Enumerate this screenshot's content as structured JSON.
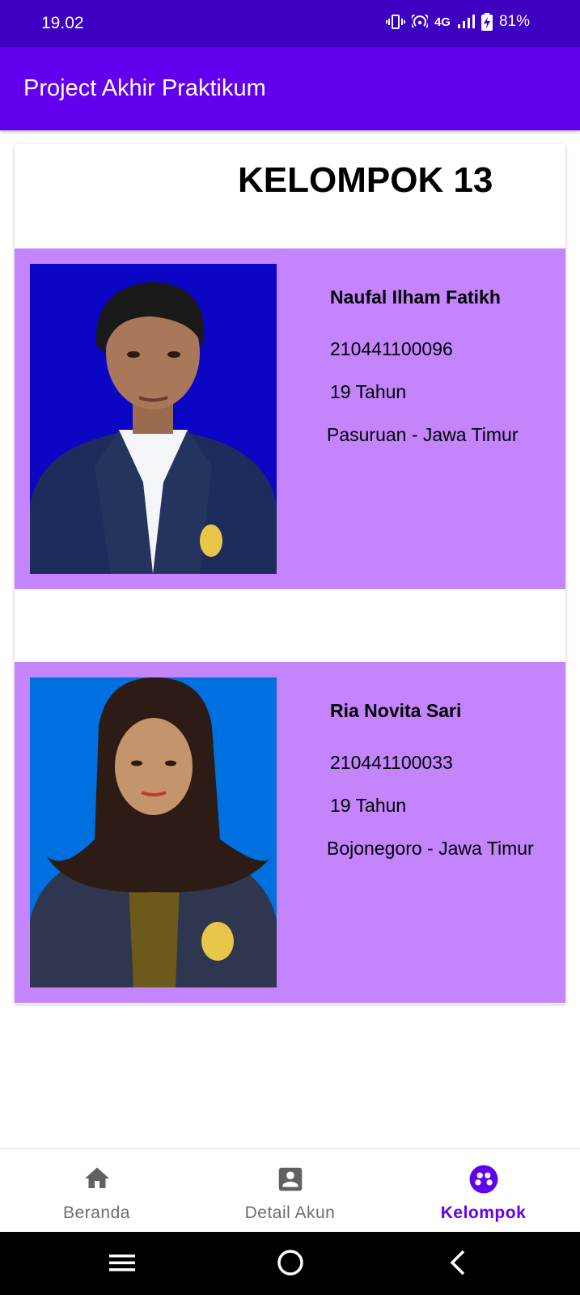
{
  "status_bar": {
    "time": "19.02",
    "network": "4G",
    "battery": "81%"
  },
  "app_bar": {
    "title": "Project Akhir Praktikum"
  },
  "group": {
    "title": "KELOMPOK 13"
  },
  "members": [
    {
      "name": "Naufal Ilham Fatikh",
      "nim": "210441100096",
      "age": "19 Tahun",
      "city": "Pasuruan - Jawa Timur"
    },
    {
      "name": "Ria Novita Sari",
      "nim": "210441100033",
      "age": "19 Tahun",
      "city": "Bojonegoro - Jawa Timur"
    }
  ],
  "bottom_nav": {
    "items": [
      {
        "label": "Beranda",
        "icon": "home-icon",
        "active": false
      },
      {
        "label": "Detail Akun",
        "icon": "account-box-icon",
        "active": false
      },
      {
        "label": "Kelompok",
        "icon": "group-icon",
        "active": true
      }
    ]
  },
  "colors": {
    "status_bar": "#3e00c1",
    "app_bar": "#6200ee",
    "member_card": "#c384fc",
    "active_nav": "#6200ee"
  }
}
